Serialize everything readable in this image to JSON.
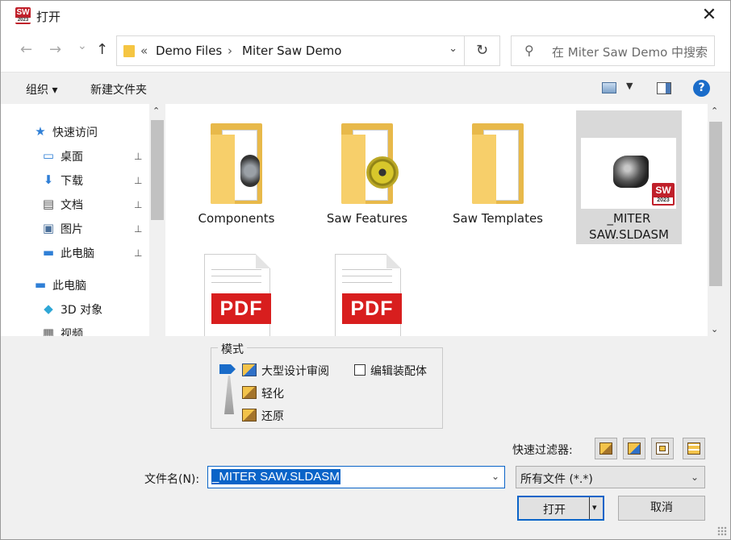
{
  "window": {
    "title": "打开",
    "app_icon_text": "SW",
    "app_icon_sub": "2023",
    "close_glyph": "✕"
  },
  "nav": {
    "back_glyph": "←",
    "forward_glyph": "→",
    "recent_glyph": "⌄",
    "up_glyph": "↑",
    "overflow": "«",
    "breadcrumb": [
      "Demo Files",
      "Miter Saw Demo"
    ],
    "breadcrumb_sep": "›",
    "refresh_glyph": "↻",
    "search_placeholder": "在 Miter Saw Demo 中搜索"
  },
  "toolbar": {
    "organize": "组织 ▾",
    "new_folder": "新建文件夹",
    "help": "?"
  },
  "sidebar": {
    "items": [
      {
        "label": "快速访问",
        "icon": "star-icon",
        "glyph": "★",
        "color": "#2f7fd6",
        "pinned": false
      },
      {
        "label": "桌面",
        "icon": "desktop-icon",
        "glyph": "▭",
        "color": "#2f7fd6",
        "pinned": true
      },
      {
        "label": "下载",
        "icon": "download-icon",
        "glyph": "⬇",
        "color": "#2f7fd6",
        "pinned": true
      },
      {
        "label": "文档",
        "icon": "document-icon",
        "glyph": "▤",
        "color": "#555555",
        "pinned": true
      },
      {
        "label": "图片",
        "icon": "picture-icon",
        "glyph": "▣",
        "color": "#4a6f9a",
        "pinned": true
      },
      {
        "label": "此电脑",
        "icon": "computer-icon",
        "glyph": "▬",
        "color": "#2f7fd6",
        "pinned": true
      },
      {
        "label": "此电脑",
        "icon": "computer-icon",
        "glyph": "▬",
        "color": "#2f7fd6",
        "pinned": false
      },
      {
        "label": "3D 对象",
        "icon": "cube-3d-icon",
        "glyph": "◆",
        "color": "#2fa7d6",
        "pinned": false
      },
      {
        "label": "视频",
        "icon": "video-icon",
        "glyph": "▦",
        "color": "#555555",
        "pinned": false
      }
    ],
    "pin_glyph": "📌"
  },
  "files": [
    {
      "name": "Components",
      "kind": "folder"
    },
    {
      "name": "Saw Features",
      "kind": "folder"
    },
    {
      "name": "Saw Templates",
      "kind": "folder"
    },
    {
      "name": "_MITER SAW.SLDASM",
      "kind": "assembly",
      "selected": true
    },
    {
      "name": "",
      "kind": "pdf",
      "badge": "PDF"
    },
    {
      "name": "",
      "kind": "pdf",
      "badge": "PDF"
    }
  ],
  "scroll": {
    "up": "⌃",
    "down": "⌄"
  },
  "mode": {
    "title": "模式",
    "options": [
      "大型设计审阅",
      "轻化",
      "还原"
    ],
    "edit_assembly_label": "编辑装配体"
  },
  "quick_filter": {
    "label": "快速过滤器:"
  },
  "filename": {
    "label": "文件名(N):",
    "value": "_MITER SAW.SLDASM"
  },
  "file_type": {
    "selected": "所有文件 (*.*)"
  },
  "buttons": {
    "open": "打开",
    "open_dropdown": "▾",
    "cancel": "取消"
  },
  "colors": {
    "accent": "#0a64c8",
    "folder": "#f7cf6a",
    "pdf_red": "#d81e1e",
    "sw_red": "#c0202a"
  }
}
